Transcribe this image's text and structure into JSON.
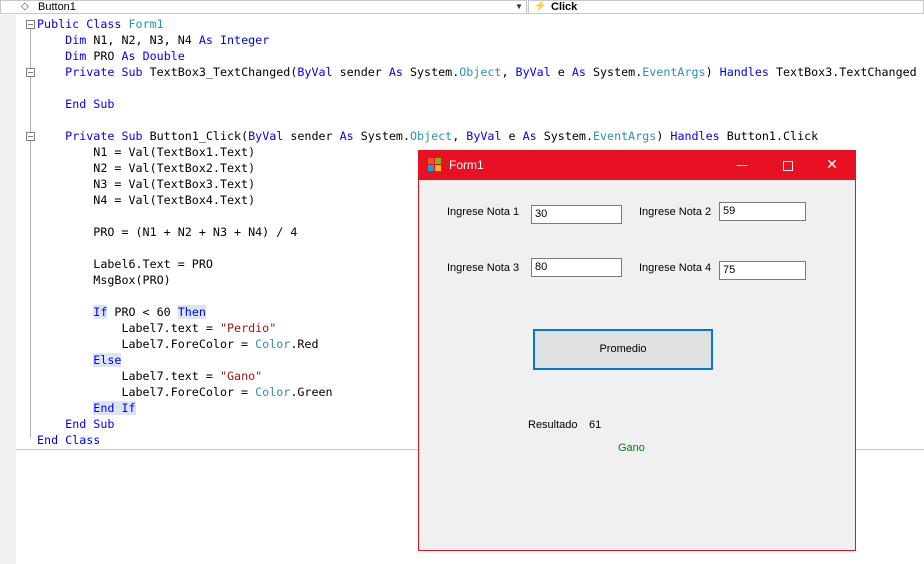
{
  "toolbar": {
    "object_combo": "Button1",
    "event_combo": "Click"
  },
  "code": {
    "lines": [
      [
        "Public Class Form1"
      ],
      [
        "    Dim N1, N2, N3, N4 As Integer"
      ],
      [
        "    Dim PRO As Double"
      ],
      [
        "    Private Sub TextBox3_TextChanged(ByVal sender As System.Object, ByVal e As System.EventArgs) Handles TextBox3.TextChanged"
      ],
      [
        ""
      ],
      [
        "    End Sub"
      ],
      [
        ""
      ],
      [
        "    Private Sub Button1_Click(ByVal sender As System.Object, ByVal e As System.EventArgs) Handles Button1.Click"
      ],
      [
        "        N1 = Val(TextBox1.Text)"
      ],
      [
        "        N2 = Val(TextBox2.Text)"
      ],
      [
        "        N3 = Val(TextBox3.Text)"
      ],
      [
        "        N4 = Val(TextBox4.Text)"
      ],
      [
        ""
      ],
      [
        "        PRO = (N1 + N2 + N3 + N4) / 4"
      ],
      [
        ""
      ],
      [
        "        Label6.Text = PRO"
      ],
      [
        "        MsgBox(PRO)"
      ],
      [
        ""
      ],
      [
        "        If PRO < 60 Then"
      ],
      [
        "            Label7.text = \"Perdio\""
      ],
      [
        "            Label7.ForeColor = Color.Red"
      ],
      [
        "        Else"
      ],
      [
        "            Label7.text = \"Gano\""
      ],
      [
        "            Label7.ForeColor = Color.Green"
      ],
      [
        "        End If"
      ],
      [
        "    End Sub"
      ],
      [
        "End Class"
      ]
    ]
  },
  "form": {
    "title": "Form1",
    "label1": "Ingrese Nota 1",
    "label2": "Ingrese Nota 2",
    "label3": "Ingrese Nota 3",
    "label4": "Ingrese Nota 4",
    "textbox1": "30",
    "textbox2": "59",
    "textbox3": "80",
    "textbox4": "75",
    "button": "Promedio",
    "result_label": "Resultado",
    "result_value": "61",
    "status": "Gano",
    "status_color": "#008000",
    "titlebar_color": "#e81123"
  }
}
